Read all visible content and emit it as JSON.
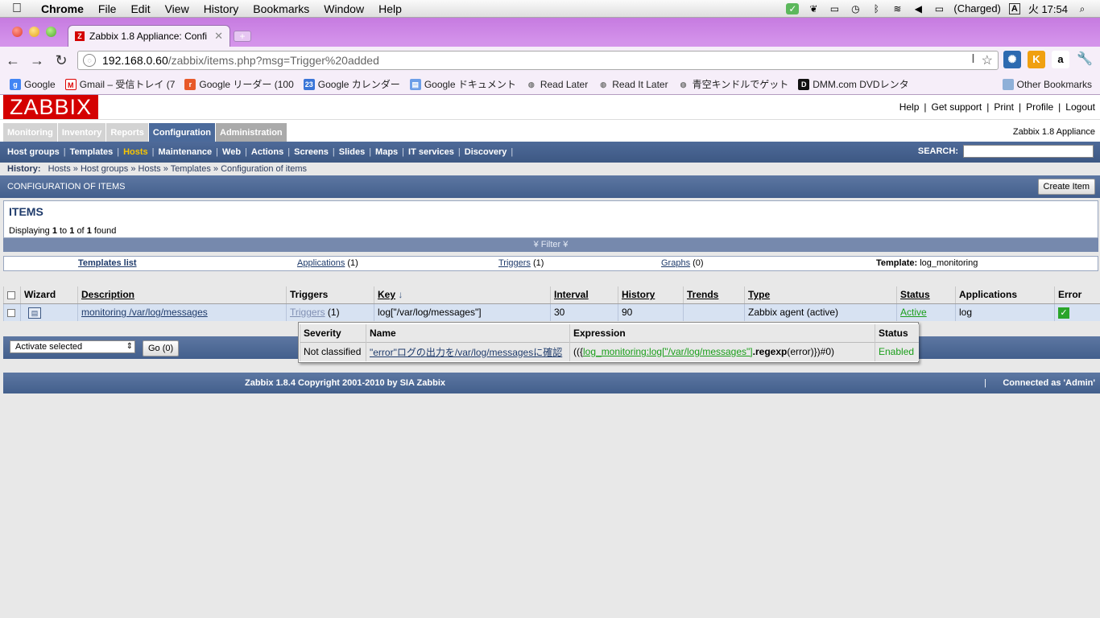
{
  "mac_menu": {
    "app": "Chrome",
    "items": [
      "File",
      "Edit",
      "View",
      "History",
      "Bookmarks",
      "Window",
      "Help"
    ],
    "battery": "(Charged)",
    "input_mode": "A",
    "clock": "火 17:54"
  },
  "browser": {
    "tab_title": "Zabbix 1.8 Appliance: Confi",
    "url_domain": "192.168.0.60",
    "url_path": "/zabbix/items.php?msg=Trigger%20added",
    "bookmarks": [
      "Google",
      "Gmail – 受信トレイ (7",
      "Google リーダー (100",
      "Google カレンダー",
      "Google ドキュメント",
      "Read Later",
      "Read It Later",
      "青空キンドルでゲット",
      "DMM.com DVDレンタ"
    ],
    "other_bookmarks": "Other Bookmarks",
    "calendar_icon_text": "23"
  },
  "zabbix": {
    "logo": "ZABBIX",
    "top_links": [
      "Help",
      "Get support",
      "Print",
      "Profile",
      "Logout"
    ],
    "main_menu": [
      "Monitoring",
      "Inventory",
      "Reports",
      "Configuration",
      "Administration"
    ],
    "appliance": "Zabbix 1.8 Appliance",
    "sub_menu": [
      "Host groups",
      "Templates",
      "Hosts",
      "Maintenance",
      "Web",
      "Actions",
      "Screens",
      "Slides",
      "Maps",
      "IT services",
      "Discovery"
    ],
    "search_label": "SEARCH:",
    "history_label": "History:",
    "history": [
      "Hosts",
      "Host groups",
      "Hosts",
      "Templates",
      "Configuration of items"
    ],
    "config_title": "CONFIGURATION OF ITEMS",
    "create_button": "Create Item",
    "items_title": "ITEMS",
    "displaying": {
      "pre": "Displaying",
      "from": "1",
      "to_word": "to",
      "to": "1",
      "of_word": "of",
      "total": "1",
      "found": "found"
    },
    "filter_label": "Filter",
    "links": {
      "templates_list": "Templates list",
      "applications": "Applications",
      "applications_count": "(1)",
      "triggers": "Triggers",
      "triggers_count": "(1)",
      "graphs": "Graphs",
      "graphs_count": "(0)",
      "template_label": "Template:",
      "template_name": "log_monitoring"
    },
    "table": {
      "headers": [
        "Wizard",
        "Description",
        "Triggers",
        "Key",
        "Interval",
        "History",
        "Trends",
        "Type",
        "Status",
        "Applications",
        "Error"
      ],
      "row": {
        "description": "monitoring /var/log/messages",
        "triggers_link": "Triggers",
        "triggers_count": "(1)",
        "key": "log[\"/var/log/messages\"]",
        "interval": "30",
        "history": "90",
        "trends": "",
        "type": "Zabbix agent (active)",
        "status": "Active",
        "applications": "log"
      }
    },
    "popup": {
      "headers": [
        "Severity",
        "Name",
        "Expression",
        "Status"
      ],
      "severity": "Not classified",
      "name": "\"error\"ログの出力を/var/log/messagesに確認",
      "expr_pre": "(({",
      "expr_link": "log_monitoring:log[\"/var/log/messages\"]",
      "expr_func": ".regexp",
      "expr_post": "(error)})#0)",
      "status": "Enabled"
    },
    "action_select": "Activate selected",
    "go_button": "Go (0)",
    "copyright": "Zabbix 1.8.4 Copyright 2001-2010 by SIA Zabbix",
    "connected_as": "Connected as 'Admin'"
  }
}
